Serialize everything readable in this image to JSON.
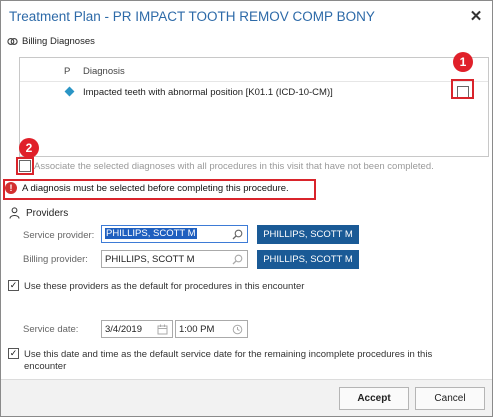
{
  "dialog": {
    "title": "Treatment Plan - PR IMPACT TOOTH REMOV COMP BONY",
    "close_icon": "close-icon"
  },
  "billing": {
    "heading": "Billing Diagnoses",
    "icon": "link-icon",
    "columns": {
      "p": "P",
      "diagnosis": "Diagnosis"
    },
    "rows": [
      {
        "text": "Impacted teeth with abnormal position [K01.1 (ICD-10-CM)]",
        "checked": false
      }
    ],
    "associate_label": "Associate the selected diagnoses with all procedures in this visit that have not been completed.",
    "associate_checked": false
  },
  "callouts": {
    "one": "1",
    "two": "2"
  },
  "error": {
    "icon": "error-icon",
    "message": "A diagnosis must be selected before completing this procedure."
  },
  "providers": {
    "heading": "Providers",
    "icon": "person-icon",
    "service_label": "Service provider:",
    "service_value": "PHILLIPS, SCOTT M",
    "service_button": "PHILLIPS, SCOTT M",
    "billing_label": "Billing provider:",
    "billing_value": "PHILLIPS, SCOTT M",
    "billing_button": "PHILLIPS, SCOTT M",
    "default_label": "Use these providers as the default for procedures in this encounter",
    "default_checked": true
  },
  "service_date": {
    "label": "Service date:",
    "date": "3/4/2019",
    "time": "1:00 PM",
    "default_label_line1": "Use this date and time as the default service date for the remaining incomplete procedures in this",
    "default_label_line2": "encounter",
    "default_checked": true
  },
  "footer": {
    "accept": "Accept",
    "cancel": "Cancel"
  },
  "colors": {
    "title": "#2d6aa8",
    "accent": "#1a5a96",
    "callout": "#e0202a",
    "error": "#d32f2f"
  }
}
